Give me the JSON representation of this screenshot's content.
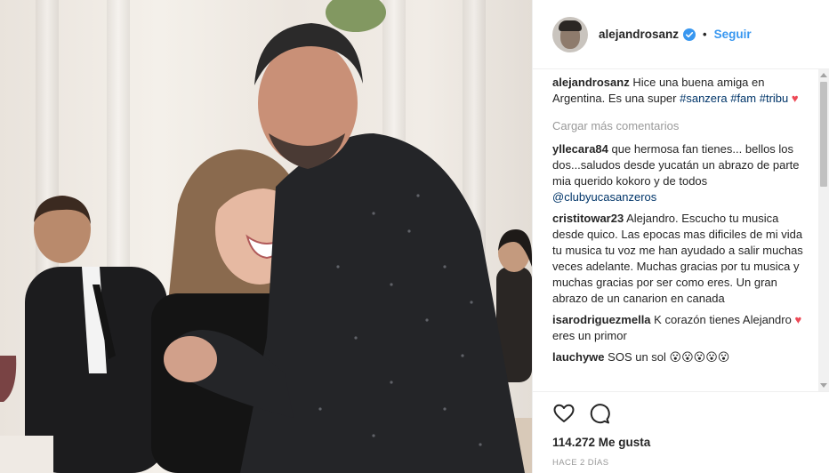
{
  "post": {
    "image_alt": "",
    "author": {
      "username": "alejandrosanz",
      "verified": true,
      "follow_label": "Seguir",
      "separator": "•"
    },
    "caption": {
      "username": "alejandrosanz",
      "text": "Hice una buena amiga en Argentina. Es una super",
      "hashtags": [
        "#sanzera",
        "#fam",
        "#tribu"
      ]
    },
    "load_more_label": "Cargar más comentarios",
    "comments": [
      {
        "username": "yllecara84",
        "text": "que hermosa fan tienes... bellos los dos...saludos desde yucatán un abrazo de parte mia querido kokoro y de todos",
        "mention": "@clubyucasanzeros"
      },
      {
        "username": "cristitowar23",
        "text": "Alejandro. Escucho tu musica desde quico. Las epocas mas dificiles de mi vida tu musica tu voz me han ayudado a salir muchas veces adelante. Muchas gracias por tu musica y muchas gracias por ser como eres. Un gran abrazo de un canarion en canada"
      },
      {
        "username": "isarodriguezmella",
        "text_before": "K corazón tienes Alejandro",
        "text_after": "eres un primor"
      },
      {
        "username": "lauchywe",
        "text": "SOS un sol",
        "emoji": "😮😮😮😮😮"
      }
    ],
    "likes_label": "114.272 Me gusta",
    "time_label": "HACE 2 DÍAS",
    "icons": {
      "like": "heart-outline-icon",
      "comment": "speech-bubble-icon",
      "verified": "verified-badge-icon"
    },
    "colors": {
      "link": "#3897f0",
      "hashtag": "#003569",
      "heart": "#ed4956",
      "muted": "#999999",
      "text": "#262626"
    }
  }
}
